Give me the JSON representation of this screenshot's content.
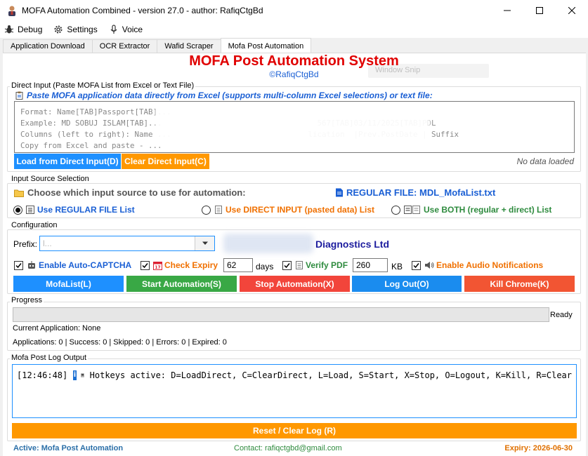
{
  "window": {
    "title": "MOFA Automation Combined - version 27.0 - author: RafiqCtgBd"
  },
  "menu": {
    "items": [
      {
        "label": "Debug",
        "icon": "bug-icon"
      },
      {
        "label": "Settings",
        "icon": "gear-icon"
      },
      {
        "label": "Voice",
        "icon": "microphone-icon"
      }
    ]
  },
  "tabs": [
    {
      "label": "Application Download"
    },
    {
      "label": "OCR Extractor"
    },
    {
      "label": "Wafid Scraper"
    },
    {
      "label": "Mofa Post Automation",
      "active": true
    }
  ],
  "header": {
    "title": "MOFA Post Automation System",
    "subtitle": "©RafiqCtgBd",
    "ghost_snip": "Window Snip"
  },
  "direct_input": {
    "legend": "Direct Input (Paste MOFA List from Excel or Text File)",
    "instruction": "Paste MOFA application data directly from Excel (supports multi-column Excel selections) or text file:",
    "lines": [
      "Format: Name[TAB]Passport[TAB]...",
      "Example: MD SOBUJ ISLAM[TAB]...                                  567[TAB]03/11/2025[TAB]PDL",
      "Columns (left to right): Name ...                              lication  |Prev.PostDate | Suffix",
      "Copy from Excel and paste - ..."
    ],
    "load_button": "Load from Direct Input(D)",
    "clear_button": "Clear Direct Input(C)",
    "status": "No data loaded"
  },
  "source_selection": {
    "legend": "Input Source Selection",
    "prompt": "Choose which input source to use for automation:",
    "regular_file": "REGULAR FILE: MDL_MofaList.txt",
    "options": [
      {
        "label": "Use REGULAR FILE List",
        "selected": true,
        "color": "#1a5fd4"
      },
      {
        "label": "Use DIRECT INPUT (pasted data) List",
        "selected": false,
        "color": "#f07000"
      },
      {
        "label": "Use BOTH (regular + direct) List",
        "selected": false,
        "color": "#2e8b3e"
      }
    ]
  },
  "configuration": {
    "legend": "Configuration",
    "prefix_label": "Prefix:",
    "prefix_value": "l...",
    "company": "Diagnostics Ltd",
    "options": {
      "captcha": {
        "label": "Enable Auto-CAPTCHA",
        "checked": true
      },
      "expiry": {
        "label": "Check Expiry",
        "checked": true,
        "value": "62",
        "unit": "days"
      },
      "pdf": {
        "label": "Verify PDF",
        "checked": true,
        "value": "260",
        "unit": "KB"
      },
      "audio": {
        "label": "Enable Audio Notifications",
        "checked": true
      }
    },
    "buttons": {
      "mofalist": "MofaList(L)",
      "start": "Start Automation(S)",
      "stop": "Stop Automation(X)",
      "logout": "Log Out(O)",
      "kill": "Kill Chrome(K)"
    }
  },
  "progress": {
    "legend": "Progress",
    "value": 0,
    "status": "Ready",
    "current": "Current Application: None",
    "stats": "Applications: 0 | Success: 0 | Skipped: 0 | Errors: 0 | Expired: 0"
  },
  "log": {
    "legend": "Mofa Post Log Output",
    "entries": [
      {
        "time": "[12:46:48]",
        "text": "Hotkeys active: D=LoadDirect, C=ClearDirect, L=Load, S=Start, X=Stop, O=Logout, K=Kill, R=Clear"
      }
    ],
    "reset_button": "Reset / Clear Log (R)"
  },
  "footer": {
    "active": "Active: Mofa Post Automation",
    "contact": "Contact: rafiqctgbd@gmail.com",
    "expiry": "Expiry: 2026-06-30"
  }
}
